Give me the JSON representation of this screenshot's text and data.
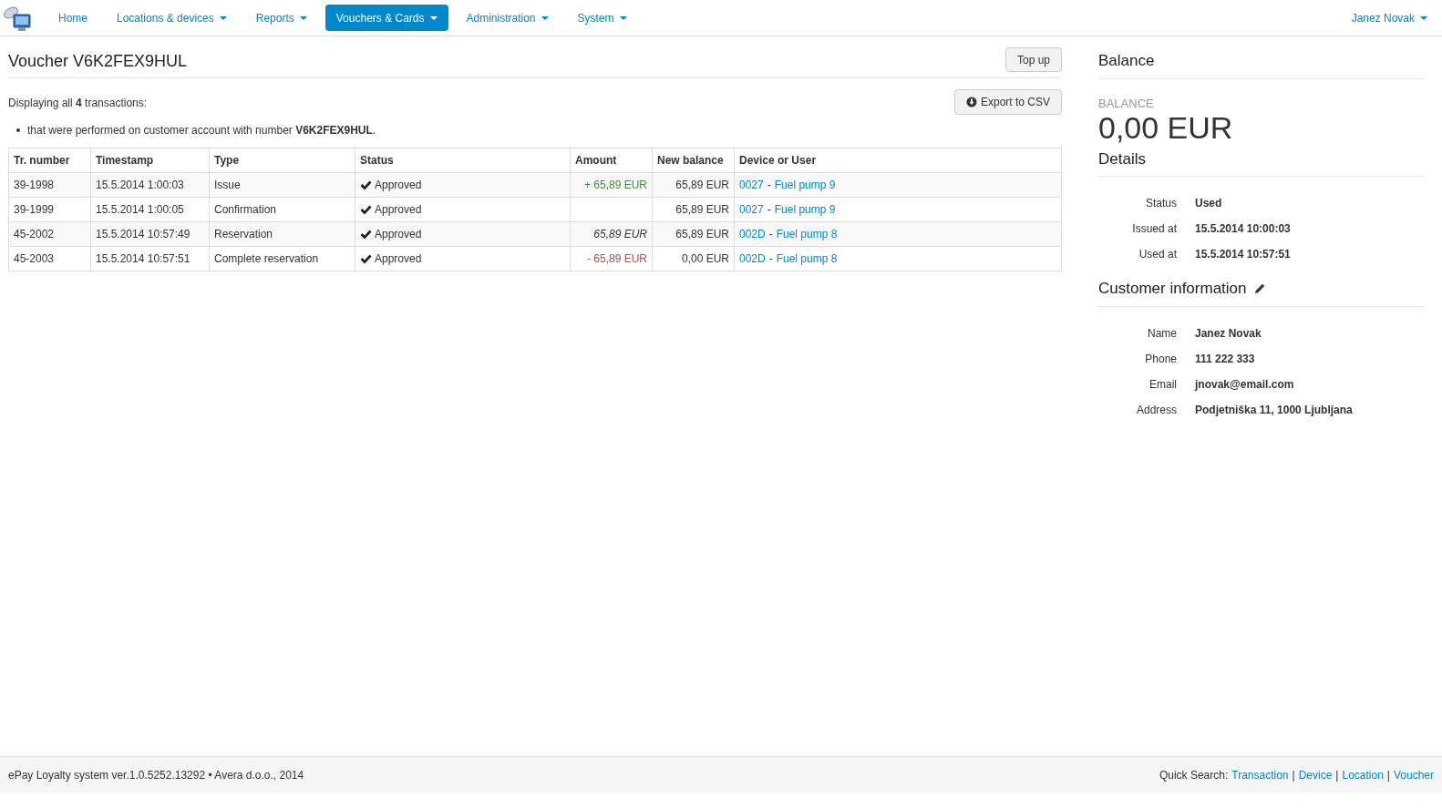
{
  "nav": {
    "items": [
      {
        "label": "Home",
        "dropdown": false,
        "selected": false
      },
      {
        "label": "Locations & devices",
        "dropdown": true,
        "selected": false
      },
      {
        "label": "Reports",
        "dropdown": true,
        "selected": false
      },
      {
        "label": "Vouchers & Cards",
        "dropdown": true,
        "selected": true
      },
      {
        "label": "Administration",
        "dropdown": true,
        "selected": false
      },
      {
        "label": "System",
        "dropdown": true,
        "selected": false
      }
    ],
    "user": "Janez Novak"
  },
  "main": {
    "title": "Voucher V6K2FEX9HUL",
    "top_up": "Top up",
    "summary": "Displaying all **4** transactions:",
    "filters": [
      "that were performed on customer account with number **V6K2FEX9HUL**."
    ],
    "export": "Export to CSV",
    "table": {
      "columns": [
        "Tr. number",
        "Timestamp",
        "Type",
        "Status",
        "Amount",
        "New balance",
        "Device or User"
      ],
      "rows": [
        {
          "number": "39-1998",
          "timestamp": "15.5.2014 1:00:03",
          "type": "Issue",
          "status": "Approved",
          "amount": {
            "text": "+ 65,89 EUR",
            "kind": "credit"
          },
          "balance": "65,89 EUR",
          "device_code": "0027",
          "device_sep": "-",
          "device_name": "Fuel pump 9"
        },
        {
          "number": "39-1999",
          "timestamp": "15.5.2014 1:00:05",
          "type": "Confirmation",
          "status": "Approved",
          "balance": "65,89 EUR",
          "device_code": "0027",
          "device_sep": "-",
          "device_name": "Fuel pump 9"
        },
        {
          "number": "45-2002",
          "timestamp": "15.5.2014 10:57:49",
          "type": "Reservation",
          "status": "Approved",
          "amount": {
            "text": "65,89 EUR",
            "kind": "reserved"
          },
          "balance": "65,89 EUR",
          "device_code": "002D",
          "device_sep": "-",
          "device_name": "Fuel pump 8"
        },
        {
          "number": "45-2003",
          "timestamp": "15.5.2014 10:57:51",
          "type": "Complete reservation",
          "status": "Approved",
          "amount": {
            "text": "- 65,89 EUR",
            "kind": "debit"
          },
          "balance": "0,00 EUR",
          "device_code": "002D",
          "device_sep": "-",
          "device_name": "Fuel pump 8"
        }
      ]
    }
  },
  "side": {
    "balance_heading": "Balance",
    "balance_label": "BALANCE",
    "balance_value": "0,00 EUR",
    "details_heading": "Details",
    "details": [
      {
        "label": "Status",
        "value": "Used"
      },
      {
        "label": "Issued at",
        "value": "15.5.2014 10:00:03"
      },
      {
        "label": "Used at",
        "value": "15.5.2014 10:57:51"
      }
    ],
    "customer_heading": "Customer information",
    "customer": [
      {
        "label": "Name",
        "value": "Janez Novak"
      },
      {
        "label": "Phone",
        "value": "111 222 333"
      },
      {
        "label": "Email",
        "value": "jnovak@email.com"
      },
      {
        "label": "Address",
        "value": "Podjetniška 11, 1000 Ljubljana"
      }
    ]
  },
  "footer": {
    "text": "ePay Loyalty system ver.1.0.5252.13292 • Avera d.o.o., 2014",
    "quick_label": "Quick Search:",
    "links": [
      "Transaction",
      "Device",
      "Location",
      "Voucher"
    ],
    "separator": "|"
  }
}
